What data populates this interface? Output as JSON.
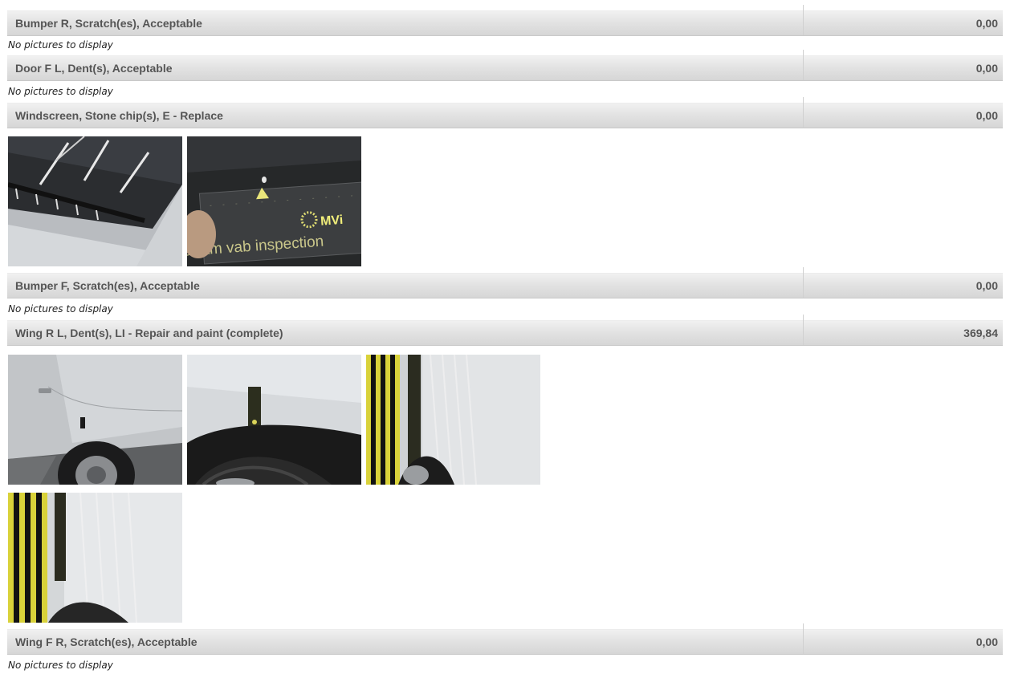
{
  "items": [
    {
      "label": "Bumper R, Scratch(es), Acceptable",
      "amount": "0,00",
      "no_pictures": "No pictures to display"
    },
    {
      "label": "Door F L, Dent(s), Acceptable",
      "amount": "0,00",
      "no_pictures": "No pictures to display"
    },
    {
      "label": "Windscreen, Stone chip(s), E - Replace",
      "amount": "0,00",
      "photos": [
        {
          "name": "windscreen-wiper-photo"
        },
        {
          "name": "stone-chip-gauge-photo",
          "gauge_text": "adam vab inspection",
          "logo_text": "MVi"
        }
      ]
    },
    {
      "label": "Bumper F, Scratch(es), Acceptable",
      "amount": "0,00",
      "no_pictures": "No pictures to display"
    },
    {
      "label": "Wing R L, Dent(s), LI - Repair and paint (complete)",
      "amount": "369,84",
      "photos": [
        {
          "name": "rear-wing-side-photo"
        },
        {
          "name": "rear-wing-gauge-photo"
        },
        {
          "name": "rear-wing-reflection-photo"
        },
        {
          "name": "rear-wing-reflection-closeup-photo"
        }
      ]
    },
    {
      "label": "Wing F R, Scratch(es), Acceptable",
      "amount": "0,00",
      "no_pictures": "No pictures to display"
    }
  ]
}
